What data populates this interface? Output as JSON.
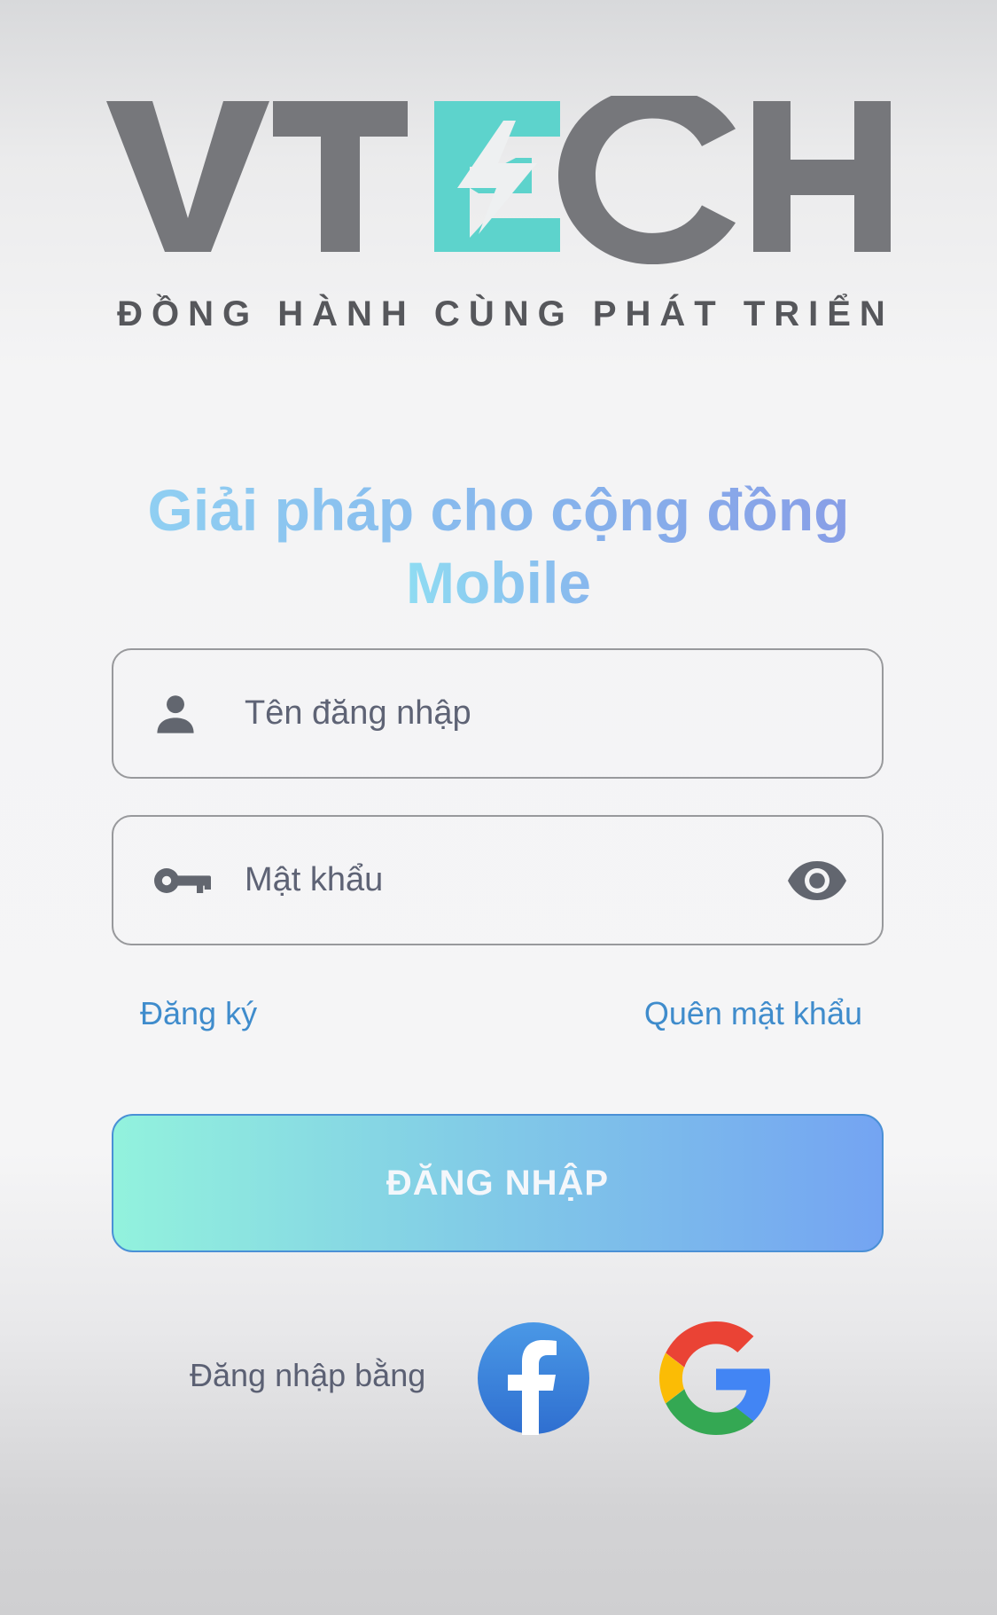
{
  "brand": {
    "logo_text": "VTECH",
    "tagline": "ĐỒNG HÀNH CÙNG PHÁT TRIỂN",
    "colors": {
      "logo_gray": "#76777b",
      "logo_teal": "#5dd3cc"
    }
  },
  "headline": {
    "line1": "Giải pháp cho cộng đồng",
    "line2": "Mobile"
  },
  "form": {
    "username": {
      "placeholder": "Tên đăng nhập",
      "value": "",
      "icon": "person-icon"
    },
    "password": {
      "placeholder": "Mật khẩu",
      "value": "",
      "icon": "key-icon",
      "toggle_icon": "eye-icon"
    },
    "register_link": "Đăng ký",
    "forgot_link": "Quên mật khẩu",
    "submit_label": "ĐĂNG NHẬP"
  },
  "social": {
    "label": "Đăng nhập bằng",
    "providers": [
      {
        "name": "facebook",
        "icon": "facebook-icon",
        "color": "#3b7ddd"
      },
      {
        "name": "google",
        "icon": "google-icon"
      }
    ]
  },
  "colors": {
    "link": "#3f8ccc",
    "button_gradient_start": "#92f2dd",
    "button_gradient_end": "#74a4f2"
  }
}
